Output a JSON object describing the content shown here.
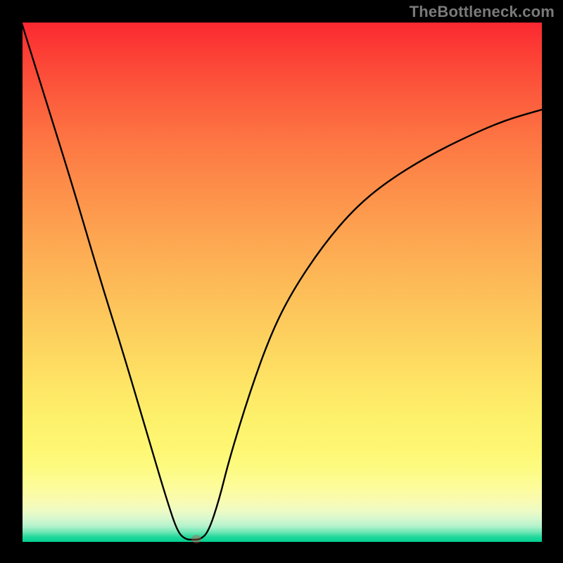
{
  "watermark": "TheBottleneck.com",
  "chart_data": {
    "type": "line",
    "title": "",
    "xlabel": "",
    "ylabel": "",
    "xlim": [
      0,
      1
    ],
    "ylim": [
      0,
      1
    ],
    "series": [
      {
        "name": "curve",
        "x": [
          0.0,
          0.05,
          0.1,
          0.15,
          0.2,
          0.25,
          0.28,
          0.3,
          0.315,
          0.33,
          0.345,
          0.36,
          0.38,
          0.4,
          0.44,
          0.48,
          0.52,
          0.58,
          0.64,
          0.7,
          0.78,
          0.86,
          0.93,
          1.0
        ],
        "y": [
          1.0,
          0.84,
          0.68,
          0.51,
          0.35,
          0.18,
          0.08,
          0.02,
          0.005,
          0.004,
          0.005,
          0.02,
          0.08,
          0.16,
          0.29,
          0.4,
          0.48,
          0.57,
          0.64,
          0.69,
          0.74,
          0.78,
          0.81,
          0.83
        ]
      }
    ],
    "marker": {
      "x": 0.335,
      "y": 0.004
    },
    "background_gradient": {
      "top": "#fb2730",
      "mid": "#fdd45f",
      "bottom": "#00cf90"
    }
  }
}
